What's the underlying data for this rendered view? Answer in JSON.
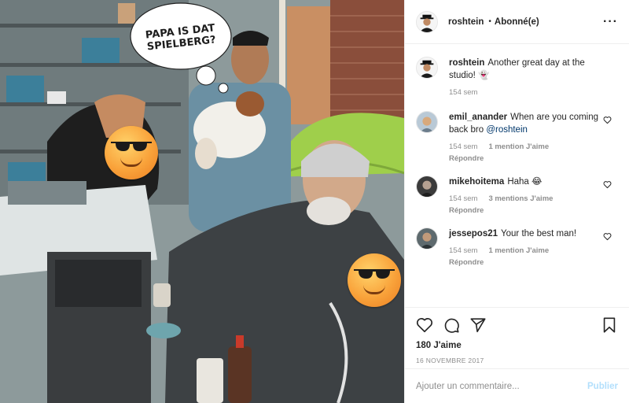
{
  "header": {
    "username": "roshtein",
    "separator": "•",
    "follow_status": "Abonné(e)",
    "more_label": "···"
  },
  "photo": {
    "speech_bubble": "PAPA IS DAT\nSPIELBERG?",
    "emoji_icon": "sunglasses-face-emoji"
  },
  "caption": {
    "username": "roshtein",
    "text": "Another great day at the studio!",
    "emoji": "👻",
    "age": "154 sem"
  },
  "comments": [
    {
      "username": "emil_anander",
      "text": "When are you coming back bro",
      "mention": "@roshtein",
      "age": "154 sem",
      "likes": "1 mention J'aime",
      "reply": "Répondre"
    },
    {
      "username": "mikehoitema",
      "text": "Haha",
      "emoji": "😂",
      "age": "154 sem",
      "likes": "3 mentions J'aime",
      "reply": "Répondre"
    },
    {
      "username": "jessepos21",
      "text": "Your the best man!",
      "age": "154 sem",
      "likes": "1 mention J'aime",
      "reply": "Répondre"
    }
  ],
  "actions": {
    "icons": [
      "heart-icon",
      "comment-icon",
      "share-icon",
      "bookmark-icon"
    ],
    "likes_count": "180 J'aime",
    "date": "16 NOVEMBRE 2017"
  },
  "add_comment": {
    "placeholder": "Ajouter un commentaire...",
    "publish_label": "Publier"
  },
  "colors": {
    "text": "#262626",
    "muted": "#8e8e8e",
    "link": "#00376b",
    "publish_disabled": "#b2dffc",
    "border": "#efefef"
  }
}
